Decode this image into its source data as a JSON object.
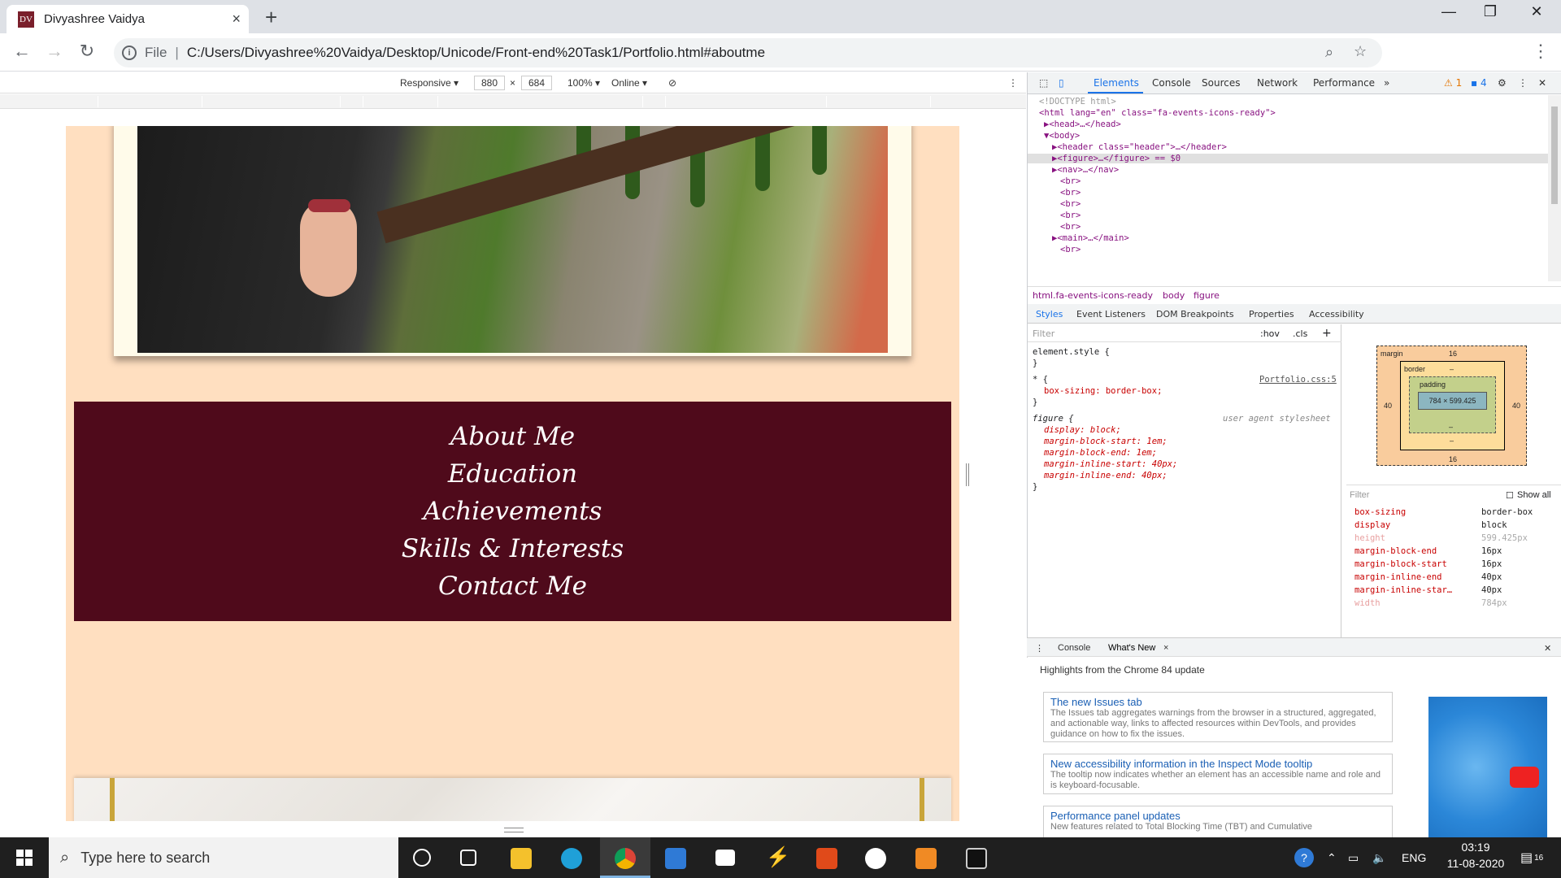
{
  "browser": {
    "tab_title": "Divyashree Vaidya",
    "tab_favicon_text": "DV",
    "file_label": "File",
    "url_sep": "|",
    "url": "C:/Users/Divyashree%20Vaidya/Desktop/Unicode/Front-end%20Task1/Portfolio.html#aboutme",
    "new_tab": "+",
    "close_tab": "×"
  },
  "device_toolbar": {
    "mode": "Responsive ▾",
    "width": "880",
    "times": "×",
    "height": "684",
    "zoom": "100% ▾",
    "network": "Online ▾"
  },
  "page": {
    "menu_items": [
      "About Me",
      "Education",
      "Achievements",
      "Skills & Interests",
      "Contact Me"
    ],
    "colors": {
      "background": "#ffdfc0",
      "menu_bg": "#4f0a1b",
      "frame": "#fffbea"
    }
  },
  "devtools": {
    "tabs": [
      "Elements",
      "Console",
      "Sources",
      "Network",
      "Performance",
      "»"
    ],
    "warnings": "⚠ 1",
    "messages": "▪ 4",
    "dom": [
      "<!DOCTYPE html>",
      "<html lang=\"en\" class=\"fa-events-icons-ready\">",
      "▶<head>…</head>",
      "▼<body>",
      "▶<header class=\"header\">…</header>",
      "▶<figure>…</figure> == $0",
      "▶<nav>…</nav>",
      "<br>",
      "<br>",
      "<br>",
      "<br>",
      "<br>",
      "▶<main>…</main>",
      "<br>"
    ],
    "breadcrumb": [
      "html.fa-events-icons-ready",
      "body",
      "figure"
    ],
    "subtabs": [
      "Styles",
      "Event Listeners",
      "DOM Breakpoints",
      "Properties",
      "Accessibility"
    ],
    "styles": {
      "filter_placeholder": "Filter",
      "hov": ":hov",
      "cls": ".cls",
      "plus": "+",
      "element_style": "element.style {",
      "close_brace": "}",
      "star_rule": "* {",
      "star_source": "Portfolio.css:5",
      "box_sizing": "box-sizing: border-box;",
      "figure_rule": "figure {",
      "figure_source": "user agent stylesheet",
      "figure_props": [
        "display: block;",
        "margin-block-start: 1em;",
        "margin-block-end: 1em;",
        "margin-inline-start: 40px;",
        "margin-inline-end: 40px;"
      ]
    },
    "box_model": {
      "margin_label": "margin",
      "border_label": "border",
      "padding_label": "padding",
      "margin_top": "16",
      "margin_bottom": "16",
      "margin_left": "40",
      "margin_right": "40",
      "dash": "–",
      "content": "784 × 599.425"
    },
    "computed": {
      "filter": "Filter",
      "show_all": "Show all",
      "rows": [
        {
          "prop": "box-sizing",
          "val": "border-box"
        },
        {
          "prop": "display",
          "val": "block"
        },
        {
          "prop": "height",
          "val": "599.425px"
        },
        {
          "prop": "margin-block-end",
          "val": "16px"
        },
        {
          "prop": "margin-block-start",
          "val": "16px"
        },
        {
          "prop": "margin-inline-end",
          "val": "40px"
        },
        {
          "prop": "margin-inline-star…",
          "val": "40px"
        },
        {
          "prop": "width",
          "val": "784px"
        }
      ]
    },
    "drawer": {
      "tabs": [
        "Console",
        "What's New"
      ],
      "close": "×",
      "heading": "Highlights from the Chrome 84 update",
      "cards": [
        {
          "title": "The new Issues tab",
          "body": "The Issues tab aggregates warnings from the browser in a structured, aggregated, and actionable way, links to affected resources within DevTools, and provides guidance on how to fix the issues."
        },
        {
          "title": "New accessibility information in the Inspect Mode tooltip",
          "body": "The tooltip now indicates whether an element has an accessible name and role and is keyboard-focusable."
        },
        {
          "title": "Performance panel updates",
          "body": "New features related to Total Blocking Time (TBT) and Cumulative"
        }
      ]
    }
  },
  "taskbar": {
    "search_placeholder": "Type here to search",
    "language": "ENG",
    "time": "03:19",
    "date": "11-08-2020",
    "notifications": "16"
  }
}
